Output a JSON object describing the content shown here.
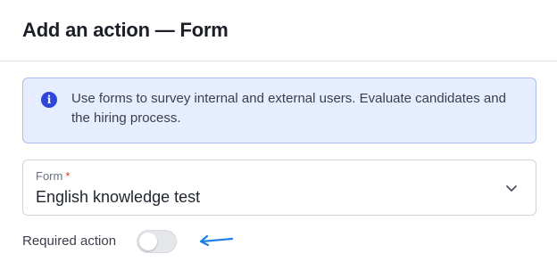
{
  "dialog": {
    "title": "Add an action — Form"
  },
  "info_banner": {
    "text": "Use forms to survey internal and external users. Evaluate candidates and the hiring process.",
    "icon": "info-icon"
  },
  "form_field": {
    "label": "Form",
    "required_marker": "*",
    "value": "English knowledge test",
    "icon": "chevron-down-icon"
  },
  "required_action": {
    "label": "Required action",
    "enabled": false
  },
  "colors": {
    "banner_bg": "#e6edff",
    "banner_border": "#a9bbf5",
    "info_icon": "#2f47d8",
    "required_marker": "#d93a2b",
    "annotation_arrow": "#1f7ee8"
  }
}
